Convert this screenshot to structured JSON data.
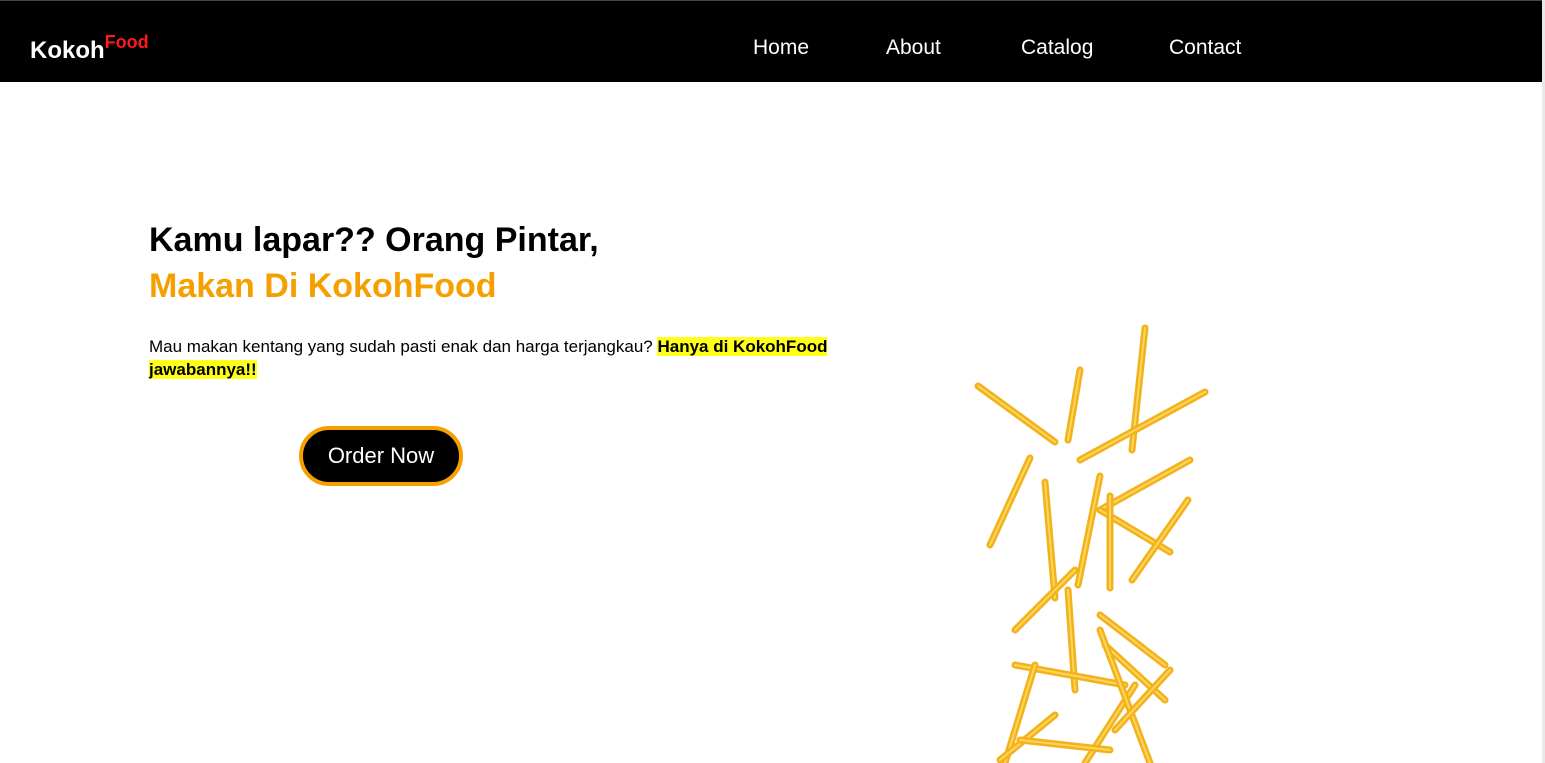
{
  "nav": {
    "brand": "Kokoh",
    "brand_sup": "Food",
    "links": [
      "Home",
      "About",
      "Catalog",
      "Contact"
    ]
  },
  "hero": {
    "headline": "Kamu lapar?? Orang Pintar,",
    "subheadline": "Makan Di KokohFood",
    "description": "Mau makan kentang yang sudah pasti enak dan harga terjangkau? ",
    "highlight": "Hanya di KokohFood jawabannya!!",
    "cta": "Order Now"
  },
  "colors": {
    "nav_bg": "#000000",
    "brand_accent": "#ff1a1a",
    "headline_accent": "#f5a000",
    "highlight_bg": "#ffff1a",
    "button_border": "#f5a000",
    "fries": "#f2b21c"
  }
}
